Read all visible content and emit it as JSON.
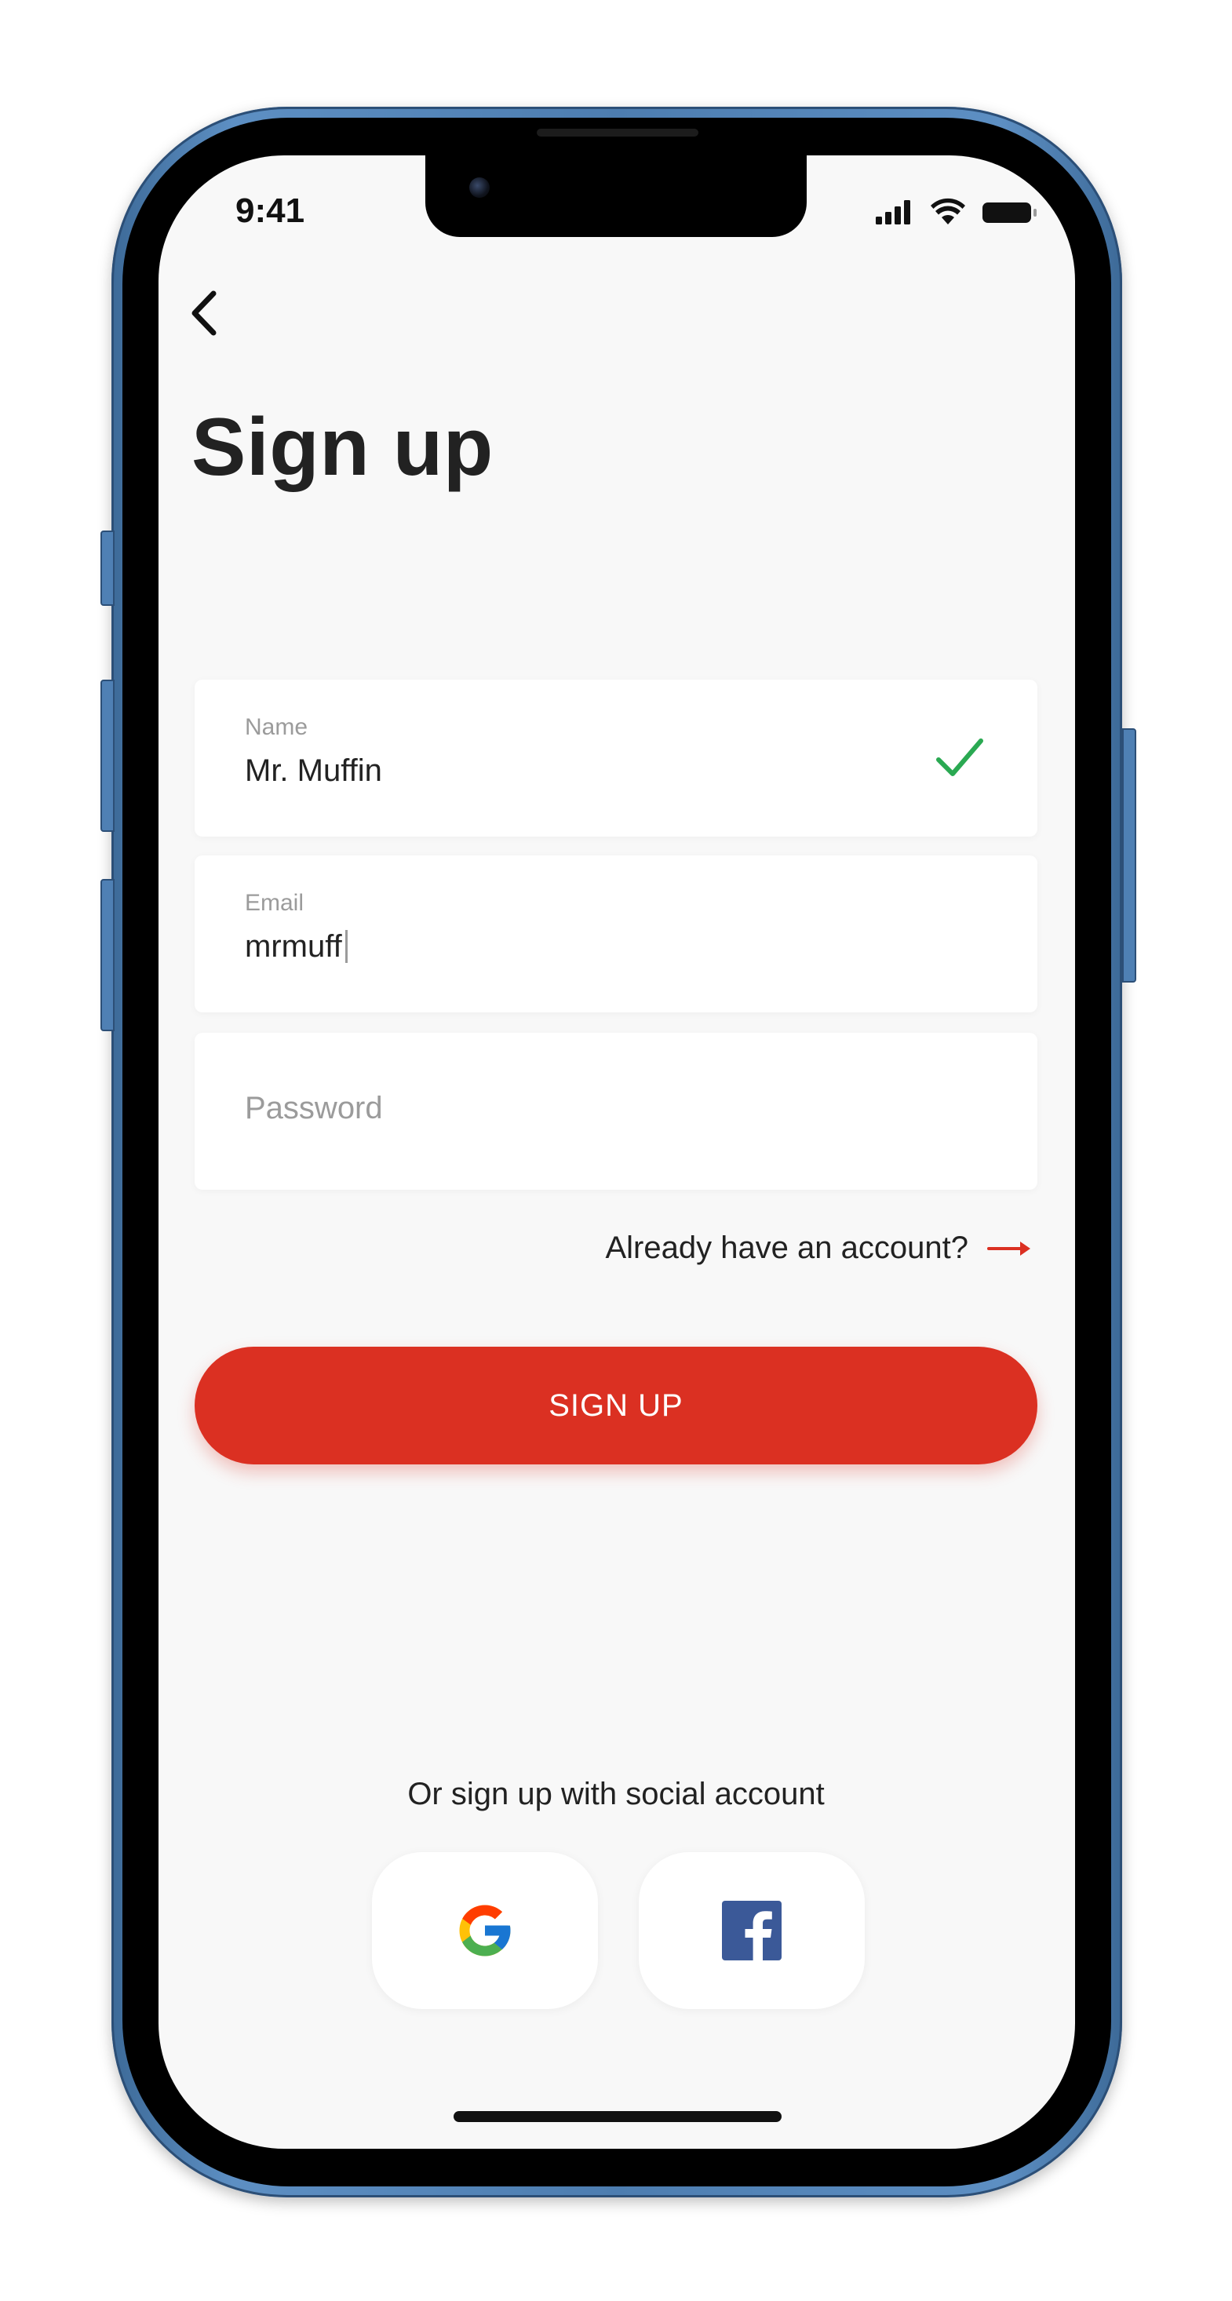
{
  "status_bar": {
    "time": "9:41"
  },
  "page": {
    "title": "Sign up"
  },
  "form": {
    "name": {
      "label": "Name",
      "value": "Mr. Muffin"
    },
    "email": {
      "label": "Email",
      "value": "mrmuff"
    },
    "password": {
      "placeholder": "Password"
    }
  },
  "links": {
    "login": "Already have an account?"
  },
  "actions": {
    "sign_up": "SIGN UP"
  },
  "social": {
    "caption": "Or sign up with social account"
  },
  "colors": {
    "accent": "#db3022",
    "success": "#2aa952",
    "background": "#f8f8f8"
  },
  "icons": {
    "back": "chevron-left-icon",
    "valid": "checkmark-icon",
    "arrow": "arrow-right-icon",
    "google": "google-logo",
    "facebook": "facebook-logo"
  }
}
